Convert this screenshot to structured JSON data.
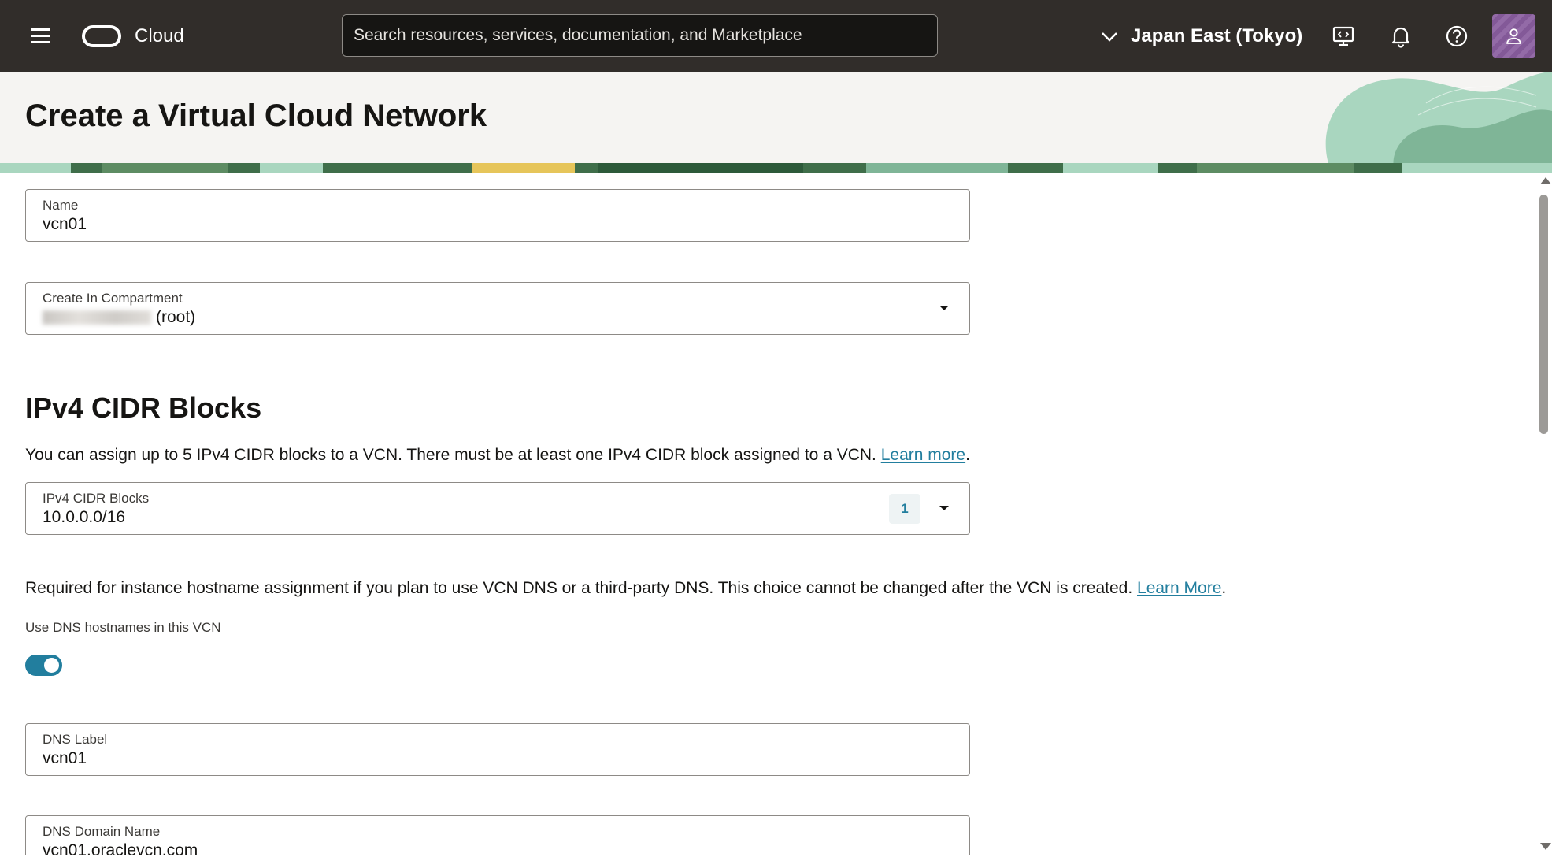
{
  "topbar": {
    "brand": "Cloud",
    "search_placeholder": "Search resources, services, documentation, and Marketplace",
    "region": "Japan East (Tokyo)",
    "icons": [
      "menu-icon",
      "oracle-logo-icon",
      "chevron-down-icon",
      "developer-tools-icon",
      "bell-icon",
      "help-icon",
      "user-avatar-icon"
    ]
  },
  "page": {
    "title": "Create a Virtual Cloud Network"
  },
  "form": {
    "name": {
      "label": "Name",
      "value": "vcn01"
    },
    "compartment": {
      "label": "Create In Compartment",
      "value": "(root)"
    },
    "ipv4_section": {
      "title": "IPv4 CIDR Blocks",
      "description": "You can assign up to 5 IPv4 CIDR blocks to a VCN. There must be at least one IPv4 CIDR block assigned to a VCN.",
      "learn_more": "Learn more",
      "period": "."
    },
    "cidr": {
      "label": "IPv4 CIDR Blocks",
      "value": "10.0.0.0/16",
      "count": "1"
    },
    "dns_info": {
      "text": "Required for instance hostname assignment if you plan to use VCN DNS or a third-party DNS. This choice cannot be changed after the VCN is created.",
      "learn_more": "Learn More",
      "period": "."
    },
    "dns_toggle": {
      "label": "Use DNS hostnames in this VCN",
      "enabled": true
    },
    "dns_label": {
      "label": "DNS Label",
      "value": "vcn01"
    },
    "dns_domain": {
      "label": "DNS Domain Name",
      "value": "vcn01.oraclevcn.com"
    }
  },
  "colors": {
    "topbar_bg": "#312d2a",
    "accent": "#227e9e",
    "header_bg": "#f5f4f2"
  }
}
